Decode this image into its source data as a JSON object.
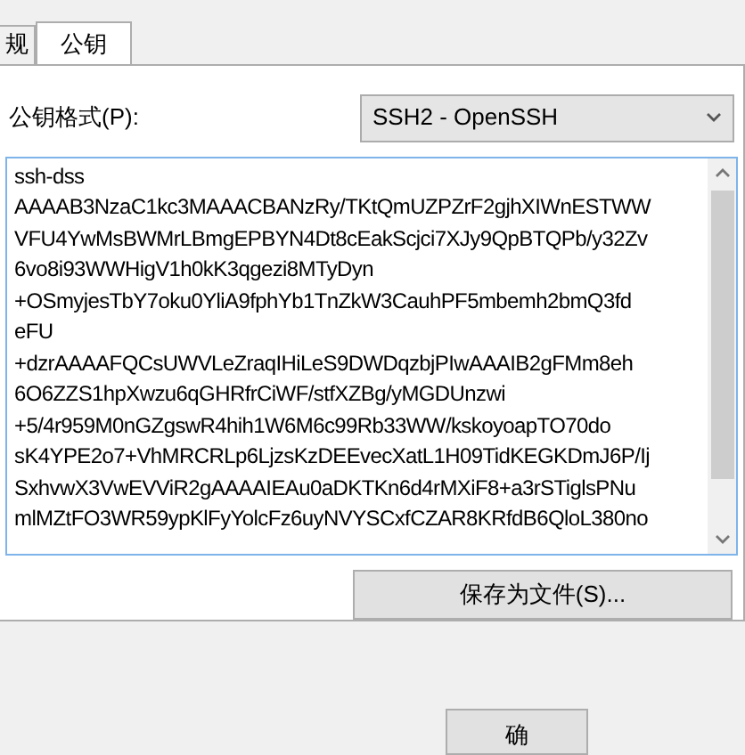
{
  "tabs": [
    {
      "label": "规",
      "selected": false
    },
    {
      "label": "公钥",
      "selected": true
    }
  ],
  "format": {
    "label": "公钥格式(P):",
    "value": "SSH2 - OpenSSH"
  },
  "key_text": [
    "ssh-dss",
    "AAAAB3NzaC1kc3MAAACBANzRy/TKtQmUZPZrF2gjhXIWnESTWW",
    "VFU4YwMsBWMrLBmgEPBYN4Dt8cEakScjci7XJy9QpBTQPb/y32Zv",
    "6vo8i93WWHigV1h0kK3qgezi8MTyDyn",
    "+OSmyjesTbY7oku0YliA9fphYb1TnZkW3CauhPF5mbemh2bmQ3fd",
    "eFU",
    "+dzrAAAAFQCsUWVLeZraqIHiLeS9DWDqzbjPIwAAAIB2gFMm8eh",
    "6O6ZZS1hpXwzu6qGHRfrCiWF/stfXZBg/yMGDUnzwi",
    "+5/4r959M0nGZgswR4hih1W6M6c99Rb33WW/kskoyoapTO70do",
    "sK4YPE2o7+VhMRCRLp6LjzsKzDEEvecXatL1H09TidKEGKDmJ6P/Ij",
    "SxhvwX3VwEVViR2gAAAAIEAu0aDKTKn6d4rMXiF8+a3rSTiglsPNu",
    "mlMZtFO3WR59ypKlFyYolcFz6uyNVYSCxfCZAR8KRfdB6QloL380no"
  ],
  "save_button": "保存为文件(S)...",
  "ok_button": "确"
}
